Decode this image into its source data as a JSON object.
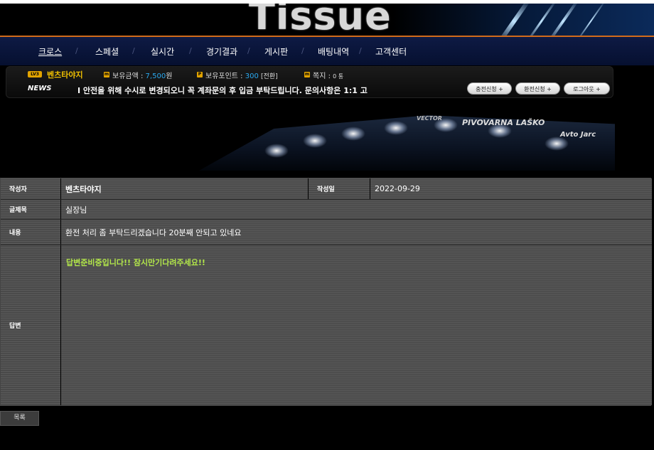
{
  "header": {
    "logo_text": "Tissue"
  },
  "nav": {
    "items": [
      {
        "label": "크로스"
      },
      {
        "label": "스페셜"
      },
      {
        "label": "실시간"
      },
      {
        "label": "경기결과"
      },
      {
        "label": "게시판"
      },
      {
        "label": "배팅내역"
      },
      {
        "label": "고객센터"
      }
    ]
  },
  "info": {
    "level_badge": "LV3",
    "username": "벤츠타야지",
    "balance_label": "보유금액 :",
    "balance_value": "7,500",
    "balance_unit": "원",
    "points_label": "보유포인트 :",
    "points_value": "300",
    "points_convert": "[전환]",
    "messages_label": "쪽지 :",
    "messages_value": "0 통",
    "news_label": "NEWS",
    "news_text": "I 안전을 위해 수시로 변경되오니 꼭 계좌문의 후 입금 부탁드립니다. 문의사항은 1:1 고",
    "buttons": [
      {
        "label": "충전신청 +"
      },
      {
        "label": "환전신청 +"
      },
      {
        "label": "로그아웃 +"
      }
    ]
  },
  "banner": {
    "ads": [
      "VECTOR",
      "PIVOVARNA LAŠKO",
      "Avto Jarc"
    ]
  },
  "detail": {
    "author_label": "작성자",
    "author_value": "벤츠타야지",
    "date_label": "작성일",
    "date_value": "2022-09-29",
    "title_label": "글제목",
    "title_value": "실장님",
    "content_label": "내용",
    "content_value": "환전 처리 좀 부탁드리겠습니다 20분째 안되고 있네요",
    "answer_label": "답변",
    "answer_value": "답변준비중입니다!! 잠시만기다려주세요!!"
  },
  "footer": {
    "list_button": "목록"
  },
  "colors": {
    "nav_accent": "#d26b1a",
    "username": "#f0c000",
    "value_blue": "#2aa9f0",
    "answer_green": "#b2e64a"
  }
}
